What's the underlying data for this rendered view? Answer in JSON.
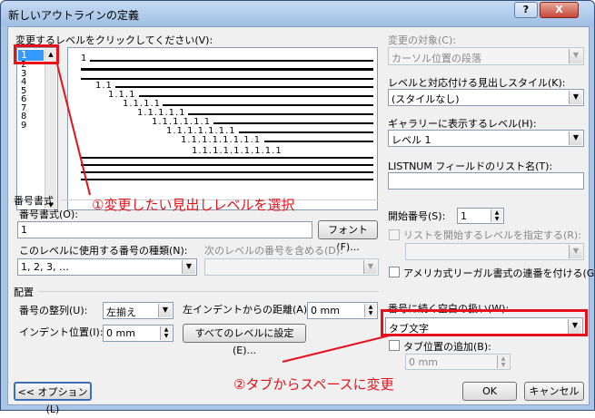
{
  "window": {
    "title": "新しいアウトラインの定義",
    "help_glyph": "?",
    "close_glyph": "X"
  },
  "levels": {
    "label": "変更するレベルをクリックしてください(V):",
    "items": [
      "1",
      "2",
      "3",
      "4",
      "5",
      "6",
      "7",
      "8",
      "9"
    ]
  },
  "preview": {
    "lines": [
      "1",
      "1.1",
      "1.1.1",
      "1.1.1.1",
      "1.1.1.1.1",
      "1.1.1.1.1.1",
      "1.1.1.1.1.1.1",
      "1.1.1.1.1.1.1.1",
      "1.1.1.1.1.1.1.1.1"
    ]
  },
  "right": {
    "target_label": "変更の対象(C):",
    "target_value": "カーソル位置の段落",
    "style_label": "レベルと対応付ける見出しスタイル(K):",
    "style_value": "(スタイルなし)",
    "gallery_label": "ギャラリーに表示するレベル(H):",
    "gallery_value": "レベル 1",
    "listnum_label": "LISTNUM フィールドのリスト名(T):",
    "listnum_value": ""
  },
  "number_format": {
    "section": "番号書式",
    "format_label": "番号書式(O):",
    "format_value": "1",
    "font_button": "フォント(F)...",
    "type_label": "このレベルに使用する番号の種類(N):",
    "type_value": "1, 2, 3, …",
    "include_label": "次のレベルの番号を含める(D):",
    "start_label": "開始番号(S):",
    "start_value": "1",
    "restart_label": "リストを開始するレベルを指定する(R):",
    "legal_label": "アメリカ式リーガル書式の連番を付ける(G)"
  },
  "placement": {
    "section": "配置",
    "align_label": "番号の整列(U):",
    "align_value": "左揃え",
    "indent_from_label": "左インデントからの距離(A):",
    "indent_from_value": "0 mm",
    "indent_label": "インデント位置(I):",
    "indent_value": "0 mm",
    "all_levels_button": "すべてのレベルに設定(E)...",
    "follow_label": "番号に続く空白の扱い(W):",
    "follow_value": "タブ文字",
    "tab_add_label": "タブ位置の追加(B):",
    "tab_add_value": "0 mm"
  },
  "buttons": {
    "options": "<< オプション(L)",
    "ok": "OK",
    "cancel": "キャンセル"
  },
  "annotations": {
    "one": "①変更したい見出しレベルを選択",
    "two": "②タブからスペースに変更"
  },
  "colors": {
    "annotation": "#e8101a",
    "title_bar": "#a9c6e6",
    "selection": "#3399ff"
  }
}
